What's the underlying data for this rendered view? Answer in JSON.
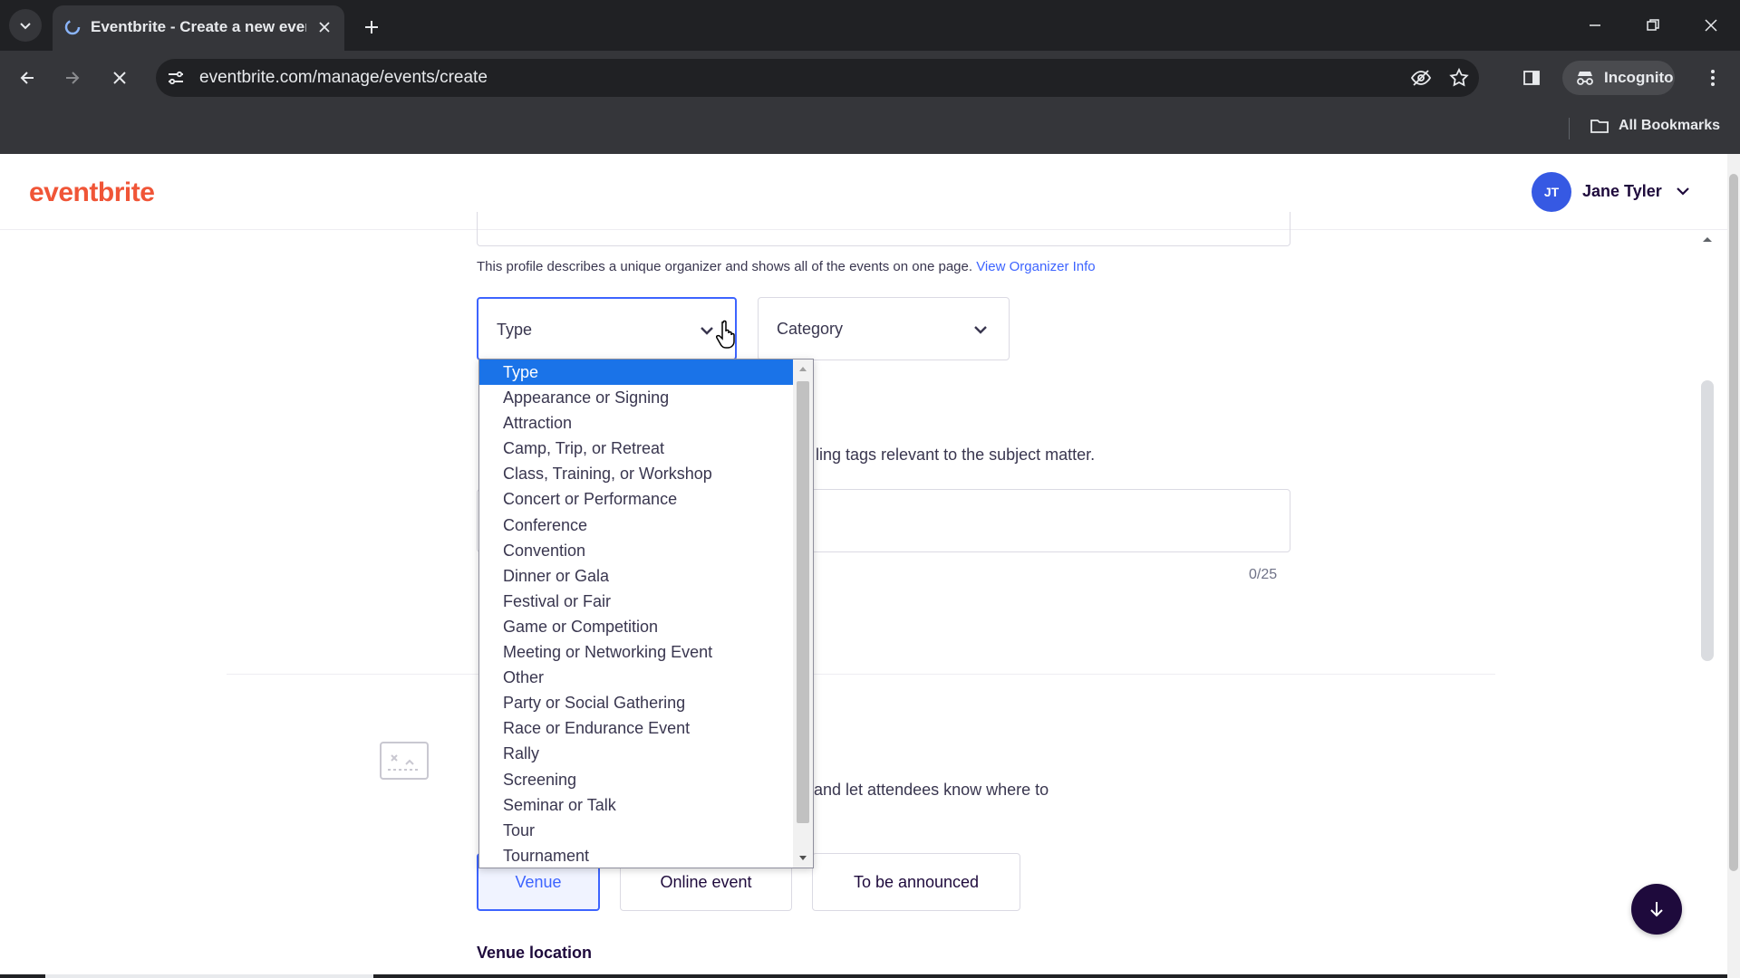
{
  "browser": {
    "tab_title": "Eventbrite - Create a new event",
    "url": "eventbrite.com/manage/events/create",
    "incognito_label": "Incognito",
    "bookmarks_label": "All Bookmarks"
  },
  "header": {
    "logo": "eventbrite",
    "avatar_initials": "JT",
    "user_name": "Jane Tyler"
  },
  "form": {
    "helper_text": "This profile describes a unique organizer and shows all of the events on one page. ",
    "helper_link": "View Organizer Info",
    "type_select_label": "Type",
    "category_select_label": "Category",
    "tags_partial_text": "ling tags relevant to the subject matter.",
    "tags_count": "0/25",
    "location_partial_text": "and let attendees know where to",
    "location_buttons": {
      "venue": "Venue",
      "online": "Online event",
      "tba": "To be announced"
    },
    "venue_location_label": "Venue location"
  },
  "dropdown": {
    "selected": "Type",
    "options": [
      "Type",
      "Appearance or Signing",
      "Attraction",
      "Camp, Trip, or Retreat",
      "Class, Training, or Workshop",
      "Concert or Performance",
      "Conference",
      "Convention",
      "Dinner or Gala",
      "Festival or Fair",
      "Game or Competition",
      "Meeting or Networking Event",
      "Other",
      "Party or Social Gathering",
      "Race or Endurance Event",
      "Rally",
      "Screening",
      "Seminar or Talk",
      "Tour",
      "Tournament"
    ]
  },
  "colors": {
    "brand": "#f05537",
    "accent": "#3d64ff",
    "selected_option": "#1a73e8",
    "chrome_dark": "#202124"
  }
}
